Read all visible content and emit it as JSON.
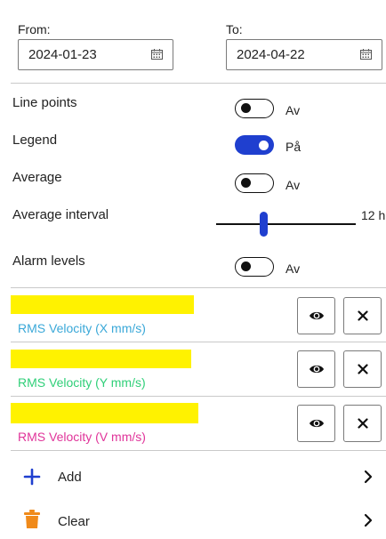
{
  "date_range": {
    "from_label": "From:",
    "from_value": "2024-01-23",
    "to_label": "To:",
    "to_value": "2024-04-22"
  },
  "settings": {
    "line_points": {
      "label": "Line points",
      "state": "Av",
      "on": false
    },
    "legend": {
      "label": "Legend",
      "state": "På",
      "on": true
    },
    "average": {
      "label": "Average",
      "state": "Av",
      "on": false
    },
    "average_interval": {
      "label": "Average interval",
      "value": "12 h"
    },
    "alarm_levels": {
      "label": "Alarm levels",
      "state": "Av",
      "on": false
    }
  },
  "series": [
    {
      "label": "RMS Velocity (X mm/s)",
      "color": "#3aa8d8",
      "highlight": "#fff200"
    },
    {
      "label": "RMS Velocity (Y mm/s)",
      "color": "#2fcf78",
      "highlight": "#fff200"
    },
    {
      "label": "RMS Velocity (V mm/s)",
      "color": "#e0349a",
      "highlight": "#fff200"
    }
  ],
  "actions": {
    "add_label": "Add",
    "clear_label": "Clear"
  },
  "colors": {
    "accent": "#1f3fcf",
    "add_icon": "#1f3fcf",
    "clear_icon": "#f08a1a"
  },
  "icons": {
    "calendar": "calendar-icon",
    "eye": "eye-icon",
    "close": "close-icon",
    "plus": "plus-icon",
    "trash": "trash-icon",
    "chevron": "chevron-right-icon"
  }
}
